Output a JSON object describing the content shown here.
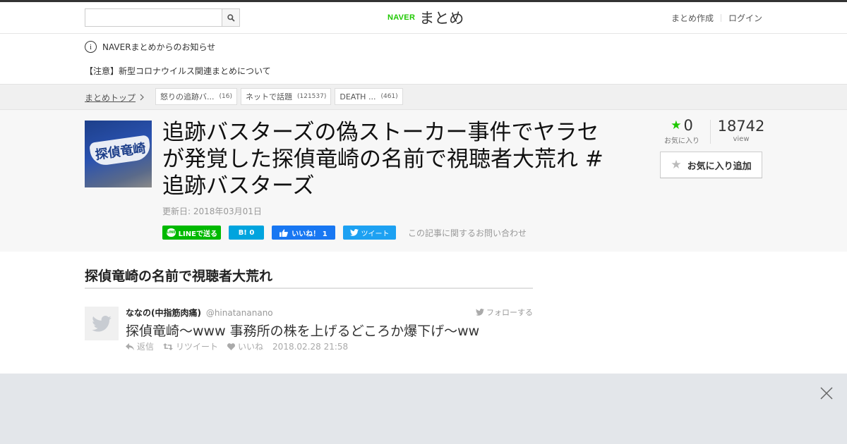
{
  "header": {
    "search_placeholder": "",
    "logo_naver": "NAVER",
    "logo_matome": "まとめ",
    "links": [
      "まとめ作成",
      "ログイン"
    ]
  },
  "notice": {
    "title": "NAVERまとめからのお知らせ",
    "message": "【注意】新型コロナウイルス関連まとめについて"
  },
  "breadcrumb": {
    "top": "まとめトップ",
    "tags": [
      {
        "label": "怒りの追跡バ...",
        "count": "(16)"
      },
      {
        "label": "ネットで話題",
        "count": "(121537)"
      },
      {
        "label": "DEATH ...",
        "count": "(461)"
      }
    ]
  },
  "article": {
    "thumb_text": "探偵竜崎",
    "title": "追跡バスターズの偽ストーカー事件でヤラセが発覚した探偵竜崎の名前で視聴者大荒れ #追跡バスターズ",
    "updated": "更新日: 2018年03月01日",
    "share": {
      "line": "LINEで送る",
      "hatena": "B! 0",
      "facebook": "いいね！ 1",
      "twitter": "ツイート",
      "inquiry": "この記事に関するお問い合わせ"
    },
    "stats": {
      "favorites": "0",
      "favorites_label": "お気に入り",
      "views": "18742",
      "views_label": "view"
    },
    "fav_button": "お気に入り追加"
  },
  "content": {
    "heading": "探偵竜崎の名前で視聴者大荒れ",
    "tweet": {
      "name": "ななの(中指筋肉痛)",
      "handle": "@hinatananano",
      "follow": "フォローする",
      "text": "探偵竜崎〜www 事務所の株を上げるどころか爆下げ〜ww",
      "reply": "返信",
      "retweet": "リツイート",
      "like": "いいね",
      "date": "2018.02.28 21:58"
    }
  },
  "colors": {
    "naver_green": "#1ec800",
    "line_green": "#00b900",
    "hatena_blue": "#00a4de",
    "facebook_blue": "#1877f2",
    "twitter_blue": "#1da1f2"
  }
}
